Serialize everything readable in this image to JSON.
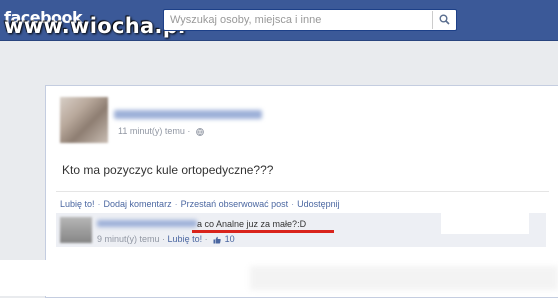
{
  "header": {
    "logo_text": "facebook",
    "watermark": "www.wiocha.pl",
    "search_placeholder": "Wyszukaj osoby, miejsca i inne",
    "search_icon": "search-icon"
  },
  "post": {
    "timestamp": "11 minut(y) temu",
    "privacy_icon": "globe-icon",
    "text": "Kto ma pozyczyc kule ortopedyczne???",
    "actions": [
      "Lubię to!",
      "Dodaj komentarz",
      "Przestań obserwować post",
      "Udostępnij"
    ]
  },
  "comment": {
    "text": "a co Analne juz za małe?:D",
    "timestamp": "9 minut(y) temu",
    "like_label": "Lubię to!",
    "like_count": "10",
    "like_icon": "thumbs-up-icon",
    "highlight_color": "#d9241c"
  }
}
